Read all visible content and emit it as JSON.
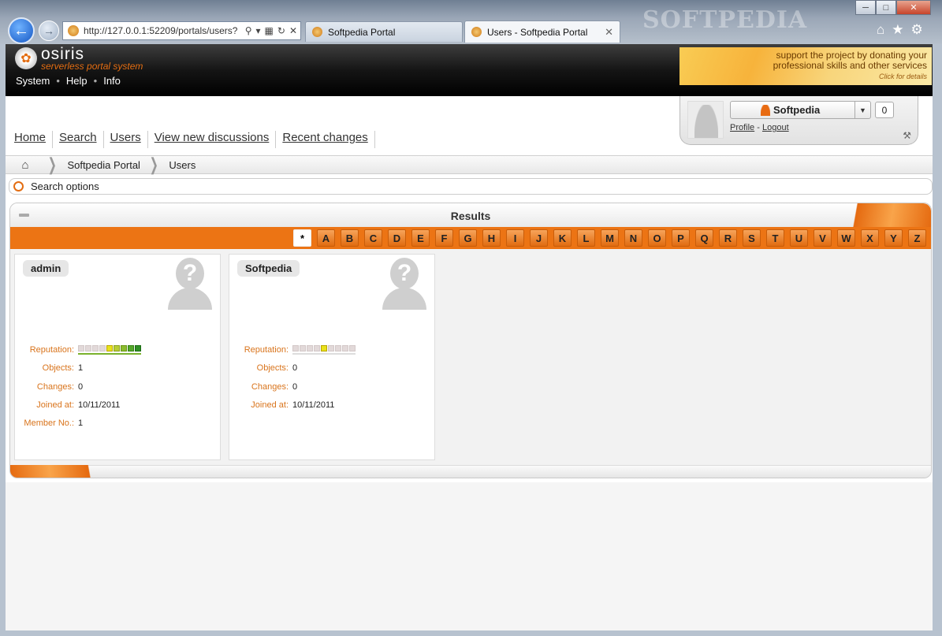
{
  "browser": {
    "address": "http://127.0.0.1:52209/portals/users?",
    "wallpaper_text": "SOFTPEDIA",
    "tabs": [
      {
        "label": "Softpedia Portal"
      },
      {
        "label": "Users - Softpedia Portal"
      }
    ]
  },
  "portal": {
    "logo_name": "osiris",
    "logo_sub": "serverless portal system",
    "top_menu": [
      "System",
      "Help",
      "Info"
    ],
    "donate": {
      "line1": "support the project by donating your",
      "line2": "professional skills and other services",
      "small": "Click for details"
    }
  },
  "nav": [
    "Home",
    "Search",
    "Users",
    "View new discussions",
    "Recent changes"
  ],
  "user_panel": {
    "name": "Softpedia",
    "count": "0",
    "profile": "Profile",
    "sep": "-",
    "logout": "Logout"
  },
  "breadcrumb": [
    "Softpedia Portal",
    "Users"
  ],
  "search_options": "Search options",
  "results": {
    "title": "Results",
    "letters": [
      "*",
      "A",
      "B",
      "C",
      "D",
      "E",
      "F",
      "G",
      "H",
      "I",
      "J",
      "K",
      "L",
      "M",
      "N",
      "O",
      "P",
      "Q",
      "R",
      "S",
      "T",
      "U",
      "V",
      "W",
      "X",
      "Y",
      "Z"
    ],
    "active_letter": "*"
  },
  "users": [
    {
      "name": "admin",
      "reputation_label": "Reputation:",
      "reputation": "5 of 9 reputation segments filled (positive)",
      "objects_label": "Objects:",
      "objects": "1",
      "changes_label": "Changes:",
      "changes": "0",
      "joined_label": "Joined at:",
      "joined": "10/11/2011",
      "member_label": "Member No.:",
      "member": "1"
    },
    {
      "name": "Softpedia",
      "reputation_label": "Reputation:",
      "reputation": "neutral",
      "objects_label": "Objects:",
      "objects": "0",
      "changes_label": "Changes:",
      "changes": "0",
      "joined_label": "Joined at:",
      "joined": "10/11/2011"
    }
  ],
  "colors": {
    "accent": "#ec7414",
    "label": "#d9741c",
    "header_dark": "#151515"
  }
}
